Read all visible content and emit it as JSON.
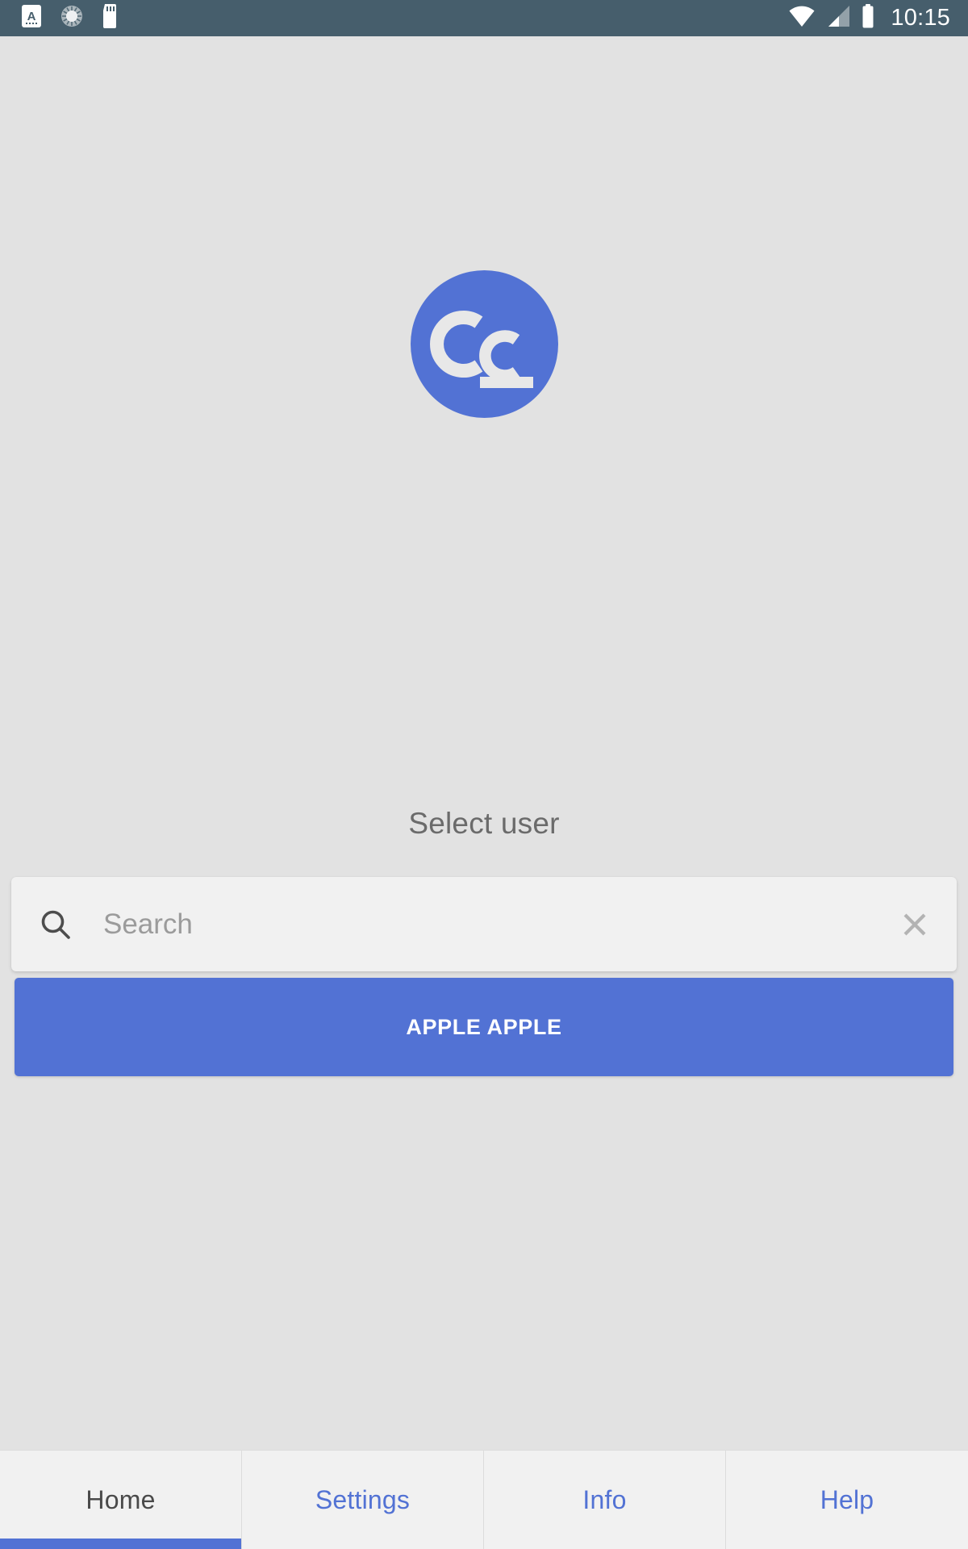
{
  "status_bar": {
    "background_color": "#465e6c",
    "time": "10:15",
    "left_icons": [
      {
        "name": "keyboard-language-icon",
        "label": "A"
      },
      {
        "name": "sync-spinner-icon",
        "label": ""
      },
      {
        "name": "sd-card-icon",
        "label": ""
      }
    ],
    "right_icons": [
      {
        "name": "wifi-icon",
        "state": "full"
      },
      {
        "name": "cellular-signal-icon",
        "state": "half"
      },
      {
        "name": "battery-icon",
        "state": "full"
      }
    ]
  },
  "logo": {
    "name": "app-logo",
    "text": "Cc",
    "circle_color": "#5272d4",
    "letter_color": "#e8e8e8"
  },
  "main": {
    "heading": "Select user",
    "search": {
      "placeholder": "Search",
      "value": "",
      "search_icon": "search-icon",
      "clear_icon": "close-icon"
    },
    "users": [
      {
        "label": "APPLE APPLE"
      }
    ],
    "accent_color": "#5272d4",
    "background_color": "#e2e2e2"
  },
  "bottom_nav": {
    "active_index": 0,
    "active_color": "#4a4a4a",
    "inactive_color": "#5272d4",
    "indicator_color": "#5272d4",
    "tabs": [
      {
        "label": "Home"
      },
      {
        "label": "Settings"
      },
      {
        "label": "Info"
      },
      {
        "label": "Help"
      }
    ]
  }
}
